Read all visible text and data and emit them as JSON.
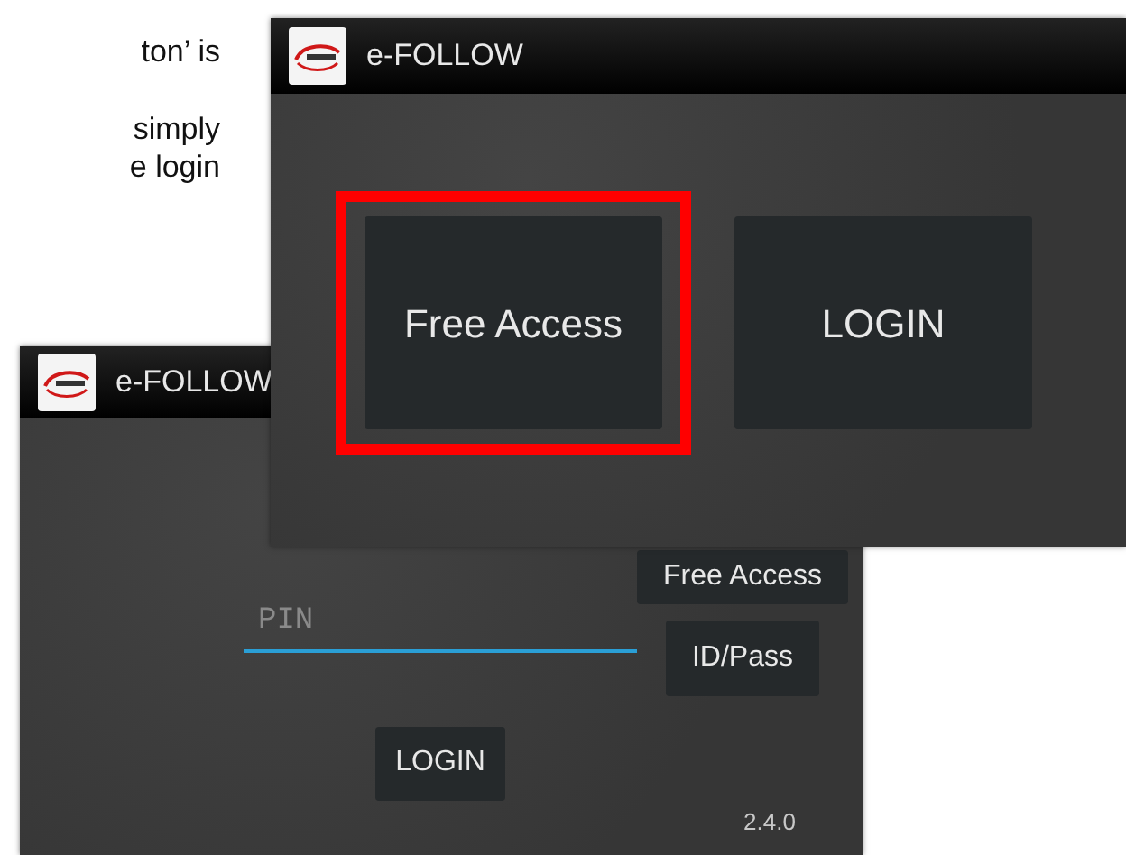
{
  "document_text": [
    "ton’ is",
    "simply",
    "e login"
  ],
  "back_window": {
    "title": "e-FOLLOW",
    "pin_field": {
      "placeholder": "PIN"
    },
    "side_buttons": [
      {
        "label": "Free Access"
      },
      {
        "label": "ID/Pass"
      }
    ],
    "login_button": {
      "label": "LOGIN"
    },
    "version": "2.4.0"
  },
  "front_window": {
    "title": "e-FOLLOW",
    "buttons": [
      {
        "label": "Free Access",
        "highlighted": true
      },
      {
        "label": "LOGIN",
        "highlighted": false
      }
    ]
  }
}
